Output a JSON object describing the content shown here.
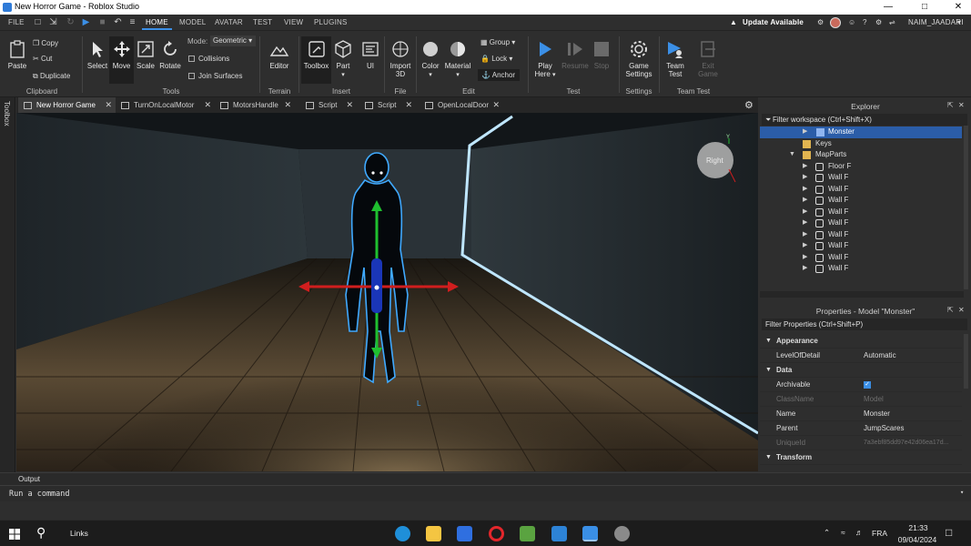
{
  "window": {
    "title": "New Horror Game - Roblox Studio"
  },
  "menubar": {
    "tabs": [
      "FILE",
      "HOME",
      "MODEL",
      "AVATAR",
      "TEST",
      "VIEW",
      "PLUGINS"
    ],
    "update_label": "Update Available",
    "user": "NAIM_JAADARI"
  },
  "ribbon": {
    "clipboard": {
      "paste": "Paste",
      "copy": "Copy",
      "cut": "Cut",
      "duplicate": "Duplicate",
      "group": "Clipboard"
    },
    "tools": {
      "select": "Select",
      "move": "Move",
      "scale": "Scale",
      "rotate": "Rotate",
      "mode_label": "Mode:",
      "mode_value": "Geometric",
      "collisions": "Collisions",
      "join_surfaces": "Join Surfaces",
      "group": "Tools"
    },
    "terrain": {
      "editor": "Editor",
      "group": "Terrain"
    },
    "insert": {
      "toolbox": "Toolbox",
      "part": "Part",
      "ui": "UI",
      "group": "Insert"
    },
    "file": {
      "import3d": "Import",
      "import3d_2": "3D",
      "group": "File"
    },
    "edit": {
      "color": "Color",
      "material": "Material",
      "group_btn": "Group",
      "lock": "Lock",
      "anchor": "Anchor",
      "group": "Edit"
    },
    "test": {
      "play_here": "Play",
      "play_here_2": "Here",
      "resume": "Resume",
      "stop": "Stop",
      "group": "Test"
    },
    "settings": {
      "game_settings": "Game",
      "game_settings_2": "Settings",
      "group": "Settings"
    },
    "team_test": {
      "team_test": "Team",
      "team_test_2": "Test",
      "exit_game": "Exit",
      "exit_game_2": "Game",
      "group": "Team Test"
    }
  },
  "left_rail": {
    "toolbox_label": "Toolbox"
  },
  "doc_tabs": [
    {
      "label": "New Horror Game"
    },
    {
      "label": "TurnOnLocalMotor"
    },
    {
      "label": "MotorsHandle"
    },
    {
      "label": "Script"
    },
    {
      "label": "Script"
    },
    {
      "label": "OpenLocalDoor"
    }
  ],
  "viewport": {
    "view_cube_label": "Right",
    "axis_y": "Y"
  },
  "explorer": {
    "title": "Explorer",
    "filter_placeholder": "Filter workspace (Ctrl+Shift+X)",
    "items": [
      {
        "label": "Monster",
        "selected": true,
        "icon": "model-icon"
      },
      {
        "label": "Keys",
        "icon": "folder-icon"
      },
      {
        "label": "MapParts",
        "icon": "folder-icon"
      },
      {
        "label": "Floor F",
        "icon": "part-icon"
      },
      {
        "label": "Wall F",
        "icon": "part-icon"
      },
      {
        "label": "Wall F",
        "icon": "part-icon"
      },
      {
        "label": "Wall F",
        "icon": "part-icon"
      },
      {
        "label": "Wall F",
        "icon": "part-icon"
      },
      {
        "label": "Wall F",
        "icon": "part-icon"
      },
      {
        "label": "Wall F",
        "icon": "part-icon"
      },
      {
        "label": "Wall F",
        "icon": "part-icon"
      },
      {
        "label": "Wall F",
        "icon": "part-icon"
      },
      {
        "label": "Wall F",
        "icon": "part-icon"
      }
    ]
  },
  "properties": {
    "title": "Properties - Model \"Monster\"",
    "filter_placeholder": "Filter Properties (Ctrl+Shift+P)",
    "rows": [
      {
        "key": "Appearance",
        "category": true
      },
      {
        "key": "LevelOfDetail",
        "value": "Automatic"
      },
      {
        "key": "Data",
        "category": true
      },
      {
        "key": "Archivable",
        "value": ""
      },
      {
        "key": "ClassName",
        "value": "Model",
        "dim": true
      },
      {
        "key": "Name",
        "value": "Monster"
      },
      {
        "key": "Parent",
        "value": "JumpScares"
      },
      {
        "key": "UniqueId",
        "value": "7a3ebf85dd97e42d06ea17d...",
        "dim": true
      },
      {
        "key": "Transform",
        "category": true
      }
    ]
  },
  "output": {
    "label": "Output"
  },
  "command": {
    "placeholder": "Run a command"
  },
  "taskbar": {
    "search_label": "Links",
    "time": "21:33",
    "date": "09/04/2024",
    "lang": "FRA"
  },
  "colors": {
    "accent": "#3b8fe6",
    "selection": "#2b5da8",
    "outline": "#3fa9ff"
  }
}
